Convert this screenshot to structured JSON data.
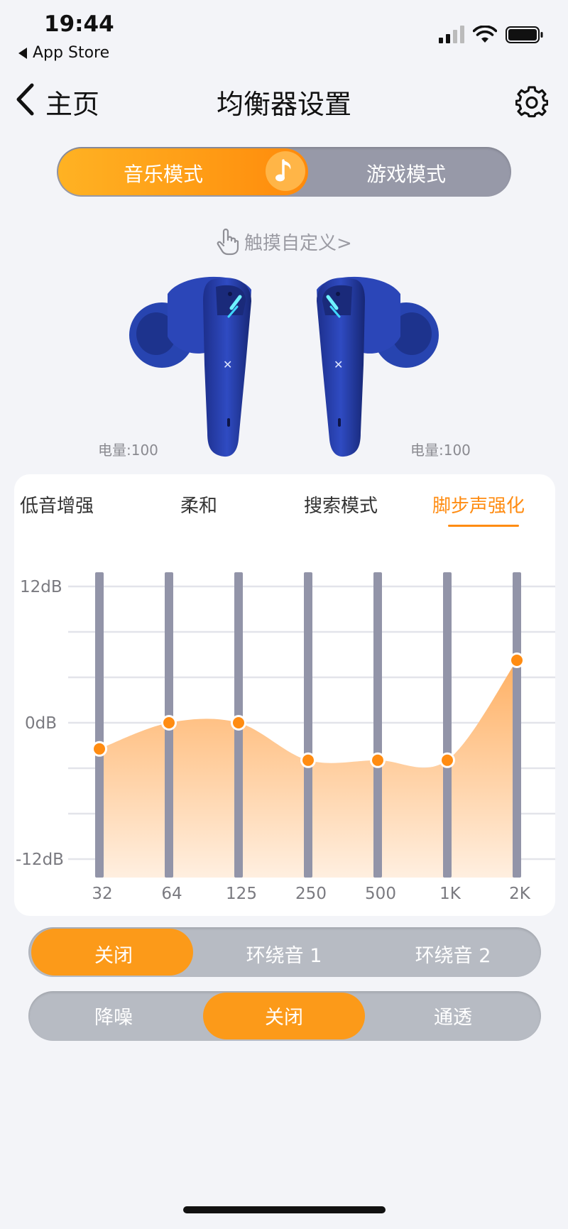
{
  "status_bar": {
    "time": "19:44",
    "back_app": "App Store"
  },
  "nav": {
    "back_label": "主页",
    "title": "均衡器设置"
  },
  "mode_toggle": {
    "music": "音乐模式",
    "game": "游戏模式",
    "active": "music"
  },
  "touch_custom": "触摸自定义>",
  "earbuds": {
    "left_battery": "电量:100",
    "right_battery": "电量:100"
  },
  "eq_presets": [
    "低音增强",
    "柔和",
    "搜索模式",
    "脚步声强化"
  ],
  "eq_active_preset": "脚步声强化",
  "chart_data": {
    "type": "area",
    "x": [
      "32",
      "64",
      "125",
      "250",
      "500",
      "1K",
      "2K"
    ],
    "values": [
      -2.3,
      0,
      0,
      -3.3,
      -3.3,
      -3.3,
      5.5
    ],
    "ylim": [
      -12,
      12
    ],
    "ytick_labels": [
      "12dB",
      "0dB",
      "-12dB"
    ],
    "colors": {
      "fill_top": "#ffb063",
      "fill_bottom": "#ffefe0",
      "marker": "#ff8c12",
      "slider": "#9294a8"
    },
    "grid": true
  },
  "surround": {
    "options": [
      "关闭",
      "环绕音 1",
      "环绕音 2"
    ],
    "active_index": 0
  },
  "noise_control": {
    "options": [
      "降噪",
      "关闭",
      "通透"
    ],
    "active_index": 1
  },
  "colors": {
    "accent": "#ff9a16",
    "background": "#f3f4f8"
  }
}
